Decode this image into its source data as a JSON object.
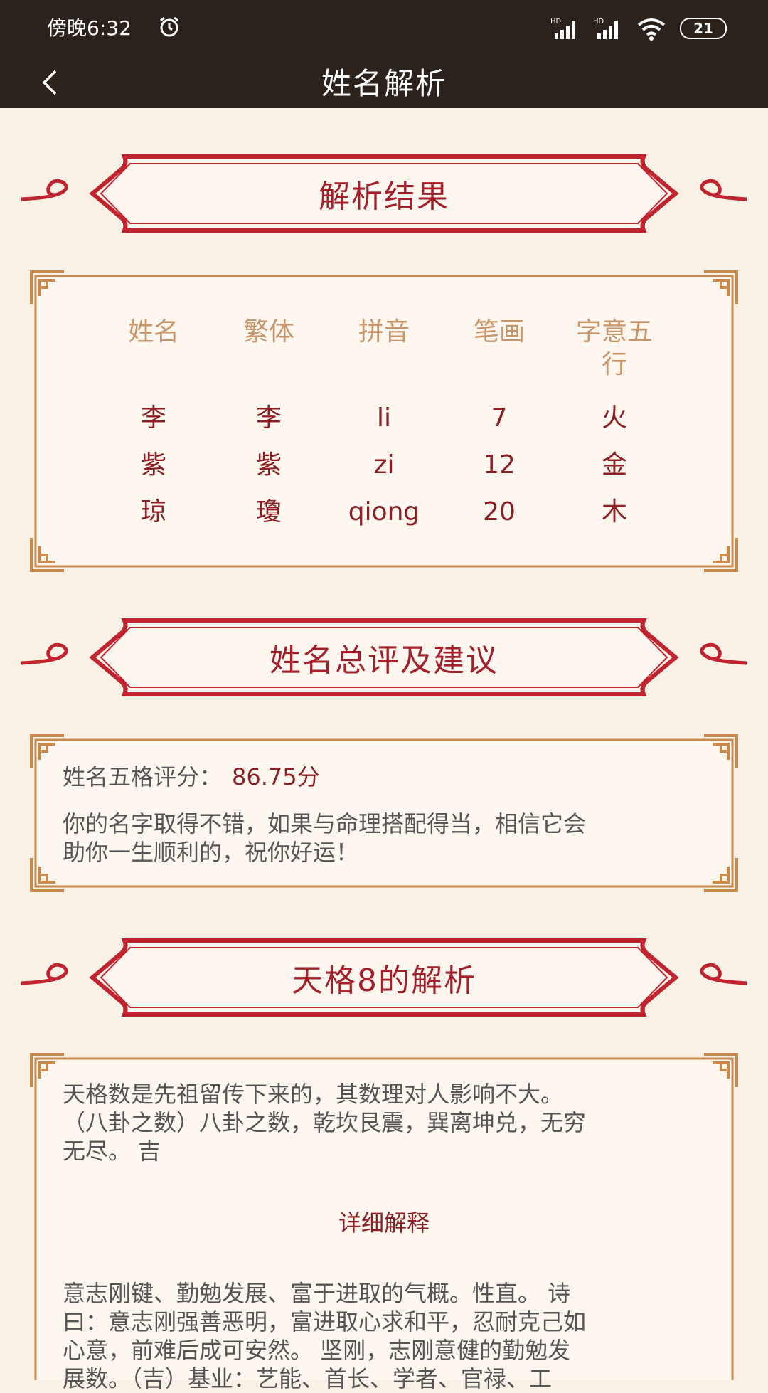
{
  "status": {
    "time": "傍晚6:32",
    "battery": "21"
  },
  "header": {
    "title": "姓名解析"
  },
  "sections": {
    "result_title": "解析结果",
    "comment_title": "姓名总评及建议",
    "tiange_title": "天格8的解析"
  },
  "table": {
    "headers": [
      "姓名",
      "繁体",
      "拼音",
      "笔画",
      "字意五",
      "行"
    ],
    "rows": [
      [
        "李",
        "李",
        "li",
        "7",
        "火"
      ],
      [
        "紫",
        "紫",
        "zi",
        "12",
        "金"
      ],
      [
        "琼",
        "瓊",
        "qiong",
        "20",
        "木"
      ]
    ]
  },
  "comment": {
    "score_label": "姓名五格评分：",
    "score_value": "86.75分",
    "text_line1": "你的名字取得不错，如果与命理搭配得当，相信它会",
    "text_line2": "助你一生顺利的，祝你好运！"
  },
  "tiange": {
    "line1": "天格数是先祖留传下来的，其数理对人影响不大。",
    "line2": "（八卦之数）八卦之数，乾坎艮震，巽离坤兑，无穷",
    "line3": "无尽。    吉",
    "detail_title": "详细解释",
    "detail_line1": "意志刚键、勤勉发展、富于进取的气概。性直。 诗",
    "detail_line2": "曰：意志刚强善恶明，富进取心求和平，忍耐克己如",
    "detail_line3": "心意，前难后成可安然。 坚刚，志刚意健的勤勉发",
    "detail_line4": "展数。（吉）基业：艺能、首长、学者、官禄、工"
  },
  "colors": {
    "dark": "#2b221c",
    "red": "#c0242e",
    "gold": "#c8894d",
    "bg": "#f9f1e6"
  }
}
